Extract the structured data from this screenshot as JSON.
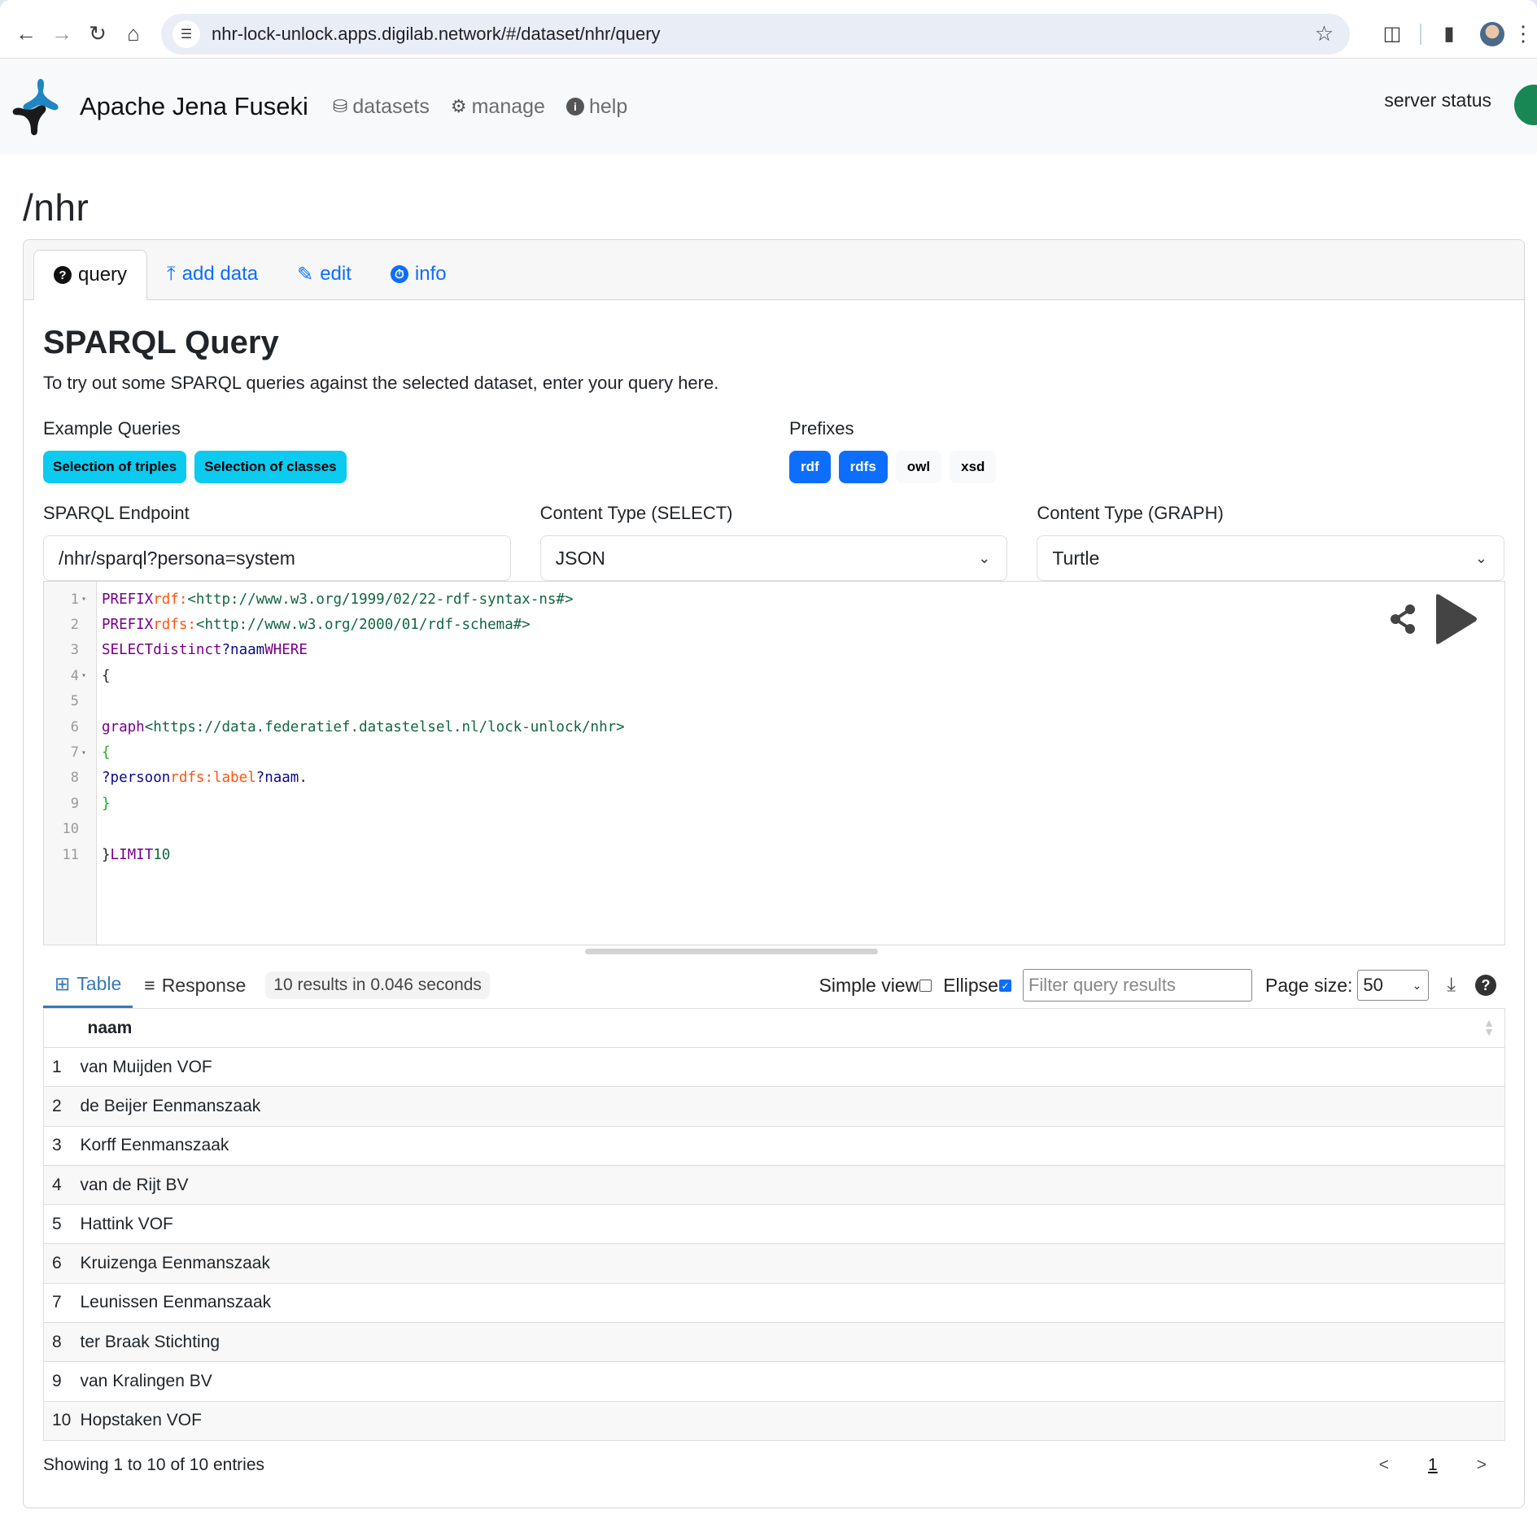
{
  "browser": {
    "url": "nhr-lock-unlock.apps.digilab.network/#/dataset/nhr/query",
    "icons": [
      "back-icon",
      "forward-icon",
      "reload-icon",
      "home-icon",
      "site-settings-icon",
      "bookmark-star-icon",
      "extensions-icon",
      "side-panel-icon",
      "profile-avatar",
      "more-menu-icon"
    ]
  },
  "navbar": {
    "brand": "Apache Jena Fuseki",
    "links": [
      {
        "label": "datasets",
        "icon": "database-icon"
      },
      {
        "label": "manage",
        "icon": "cogs-icon"
      },
      {
        "label": "help",
        "icon": "info-icon"
      }
    ],
    "server_status_label": "server status",
    "server_status_color": "#198754"
  },
  "page": {
    "title": "/nhr"
  },
  "tabs": [
    {
      "label": "query",
      "icon": "question-circle-icon",
      "active": true
    },
    {
      "label": "add data",
      "icon": "upload-icon",
      "active": false
    },
    {
      "label": "edit",
      "icon": "edit-icon",
      "active": false
    },
    {
      "label": "info",
      "icon": "dashboard-icon",
      "active": false
    }
  ],
  "query_panel": {
    "title": "SPARQL Query",
    "description": "To try out some SPARQL queries against the selected dataset, enter your query here.",
    "example_queries_label": "Example Queries",
    "example_queries": [
      "Selection of triples",
      "Selection of classes"
    ],
    "prefixes_label": "Prefixes",
    "prefixes": [
      {
        "label": "rdf",
        "active": true
      },
      {
        "label": "rdfs",
        "active": true
      },
      {
        "label": "owl",
        "active": false
      },
      {
        "label": "xsd",
        "active": false
      }
    ],
    "endpoint_label": "SPARQL Endpoint",
    "endpoint_value": "/nhr/sparql?persona=system",
    "content_type_select_label": "Content Type (SELECT)",
    "content_type_select_value": "JSON",
    "content_type_graph_label": "Content Type (GRAPH)",
    "content_type_graph_value": "Turtle"
  },
  "editor": {
    "lines": [
      {
        "n": "1",
        "fold": true
      },
      {
        "n": "2",
        "fold": false
      },
      {
        "n": "3",
        "fold": false
      },
      {
        "n": "4",
        "fold": true
      },
      {
        "n": "5",
        "fold": false
      },
      {
        "n": "6",
        "fold": false
      },
      {
        "n": "7",
        "fold": true
      },
      {
        "n": "8",
        "fold": false
      },
      {
        "n": "9",
        "fold": false
      },
      {
        "n": "10",
        "fold": false
      },
      {
        "n": "11",
        "fold": false
      }
    ],
    "tokens": {
      "l1_kw": "PREFIX",
      "l1_pfx": "rdf:",
      "l1_iri": "<http://www.w3.org/1999/02/22-rdf-syntax-ns#>",
      "l2_kw": "PREFIX",
      "l2_pfx": "rdfs:",
      "l2_iri": "<http://www.w3.org/2000/01/rdf-schema#>",
      "l3_kw1": "SELECT",
      "l3_kw2": "distinct",
      "l3_var": "?naam",
      "l3_kw3": "WHERE",
      "l4": "{",
      "l6_kw": "graph",
      "l6_iri": "<https://data.federatief.datastelsel.nl/lock-unlock/nhr>",
      "l7": "{",
      "l8_var1": "?persoon",
      "l8_pfx": "rdfs:label",
      "l8_var2": "?naam",
      "l8_dot": ".",
      "l9": "}",
      "l11_brace": "}",
      "l11_kw": "LIMIT",
      "l11_num": "10"
    }
  },
  "results": {
    "tabs": [
      {
        "label": "Table",
        "icon": "table-icon",
        "active": true
      },
      {
        "label": "Response",
        "icon": "align-left-icon",
        "active": false
      }
    ],
    "summary": "10 results in 0.046 seconds",
    "simple_view_label": "Simple view",
    "simple_view_checked": false,
    "ellipse_label": "Ellipse",
    "ellipse_checked": true,
    "filter_placeholder": "Filter query results",
    "page_size_label": "Page size:",
    "page_size_value": "50",
    "columns": [
      "naam"
    ],
    "rows": [
      {
        "idx": "1",
        "naam": "van Muijden VOF"
      },
      {
        "idx": "2",
        "naam": "de Beijer Eenmanszaak"
      },
      {
        "idx": "3",
        "naam": "Korff Eenmanszaak"
      },
      {
        "idx": "4",
        "naam": "van de Rijt BV"
      },
      {
        "idx": "5",
        "naam": "Hattink VOF"
      },
      {
        "idx": "6",
        "naam": "Kruizenga Eenmanszaak"
      },
      {
        "idx": "7",
        "naam": "Leunissen Eenmanszaak"
      },
      {
        "idx": "8",
        "naam": "ter Braak Stichting"
      },
      {
        "idx": "9",
        "naam": "van Kralingen BV"
      },
      {
        "idx": "10",
        "naam": "Hopstaken VOF"
      }
    ],
    "footer_info": "Showing 1 to 10 of 10 entries",
    "pager": {
      "prev": "<",
      "current": "1",
      "next": ">"
    }
  }
}
